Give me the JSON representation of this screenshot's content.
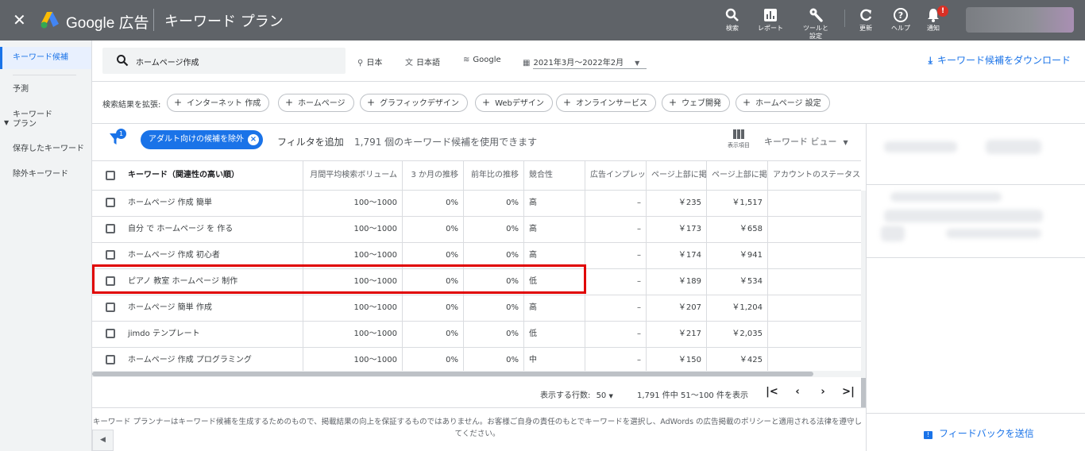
{
  "topbar": {
    "close_icon": "close-icon",
    "brand": "Google 広告",
    "title": "キーワード プラン",
    "tools": [
      {
        "label": "検索",
        "icon": "search-icon"
      },
      {
        "label": "レポート",
        "icon": "reports-icon"
      },
      {
        "label": "ツールと設定",
        "icon": "wrench-icon"
      },
      {
        "label": "更新",
        "icon": "refresh-icon"
      },
      {
        "label": "ヘルプ",
        "icon": "help-icon"
      },
      {
        "label": "通知",
        "icon": "bell-icon",
        "badge": "!"
      }
    ]
  },
  "sidebar": {
    "items": [
      {
        "label": "キーワード候補",
        "active": true
      },
      {
        "label": "予測"
      },
      {
        "label": "キーワード\nプラン",
        "expandable": true
      },
      {
        "label": "保存したキーワード"
      },
      {
        "label": "除外キーワード"
      }
    ]
  },
  "search": {
    "query": "ホームページ作成",
    "location": "日本",
    "language": "日本語",
    "network": "Google",
    "date_range": "2021年3月～2022年2月",
    "download_label": "キーワード候補をダウンロード"
  },
  "expand": {
    "label": "検索結果を拡張:",
    "pills": [
      "インターネット 作成",
      "ホームページ",
      "グラフィックデザイン",
      "Webデザイン",
      "オンラインサービス",
      "ウェブ開発",
      "ホームページ 設定"
    ]
  },
  "filters": {
    "badge": "1",
    "active_chip": "アダルト向けの候補を除外",
    "add_filter": "フィルタを追加",
    "available": "1,791 個のキーワード候補を使用できます",
    "columns_label": "表示項目",
    "view_label": "キーワード ビュー"
  },
  "table": {
    "headers": [
      "キーワード（関連性の高い順）",
      "月間平均検索ボリューム",
      "3 か月の推移",
      "前年比の推移",
      "競合性",
      "広告インプレッション シェア",
      "ページ上部に掲載された入札単価（低額帯）",
      "ページ上部に掲載された入札単価（高額帯）",
      "アカウントのステータス"
    ],
    "header_display": [
      "キーワード（関連性の高い順）",
      "月間平均検索ボリューム",
      "3 か月の推移",
      "前年比の推移",
      "競合性",
      "広告インプレッ",
      "ページ上部に掲",
      "ページ上部に掲",
      "アカウントのステータス"
    ],
    "rows": [
      [
        "ホームページ 作成 簡単",
        "100～1000",
        "0%",
        "0%",
        "高",
        "–",
        "￥235",
        "￥1,517",
        ""
      ],
      [
        "自分 で ホームページ を 作る",
        "100～1000",
        "0%",
        "0%",
        "高",
        "–",
        "￥173",
        "￥658",
        ""
      ],
      [
        "ホームページ 作成 初心者",
        "100～1000",
        "0%",
        "0%",
        "高",
        "–",
        "￥174",
        "￥941",
        ""
      ],
      [
        "ピアノ 教室 ホームページ 制作",
        "100～1000",
        "0%",
        "0%",
        "低",
        "–",
        "￥189",
        "￥534",
        ""
      ],
      [
        "ホームページ 簡単 作成",
        "100～1000",
        "0%",
        "0%",
        "高",
        "–",
        "￥207",
        "￥1,204",
        ""
      ],
      [
        "jimdo テンプレート",
        "100～1000",
        "0%",
        "0%",
        "低",
        "–",
        "￥217",
        "￥2,035",
        ""
      ],
      [
        "ホームページ 作成 プログラミング",
        "100～1000",
        "0%",
        "0%",
        "中",
        "–",
        "￥150",
        "￥425",
        ""
      ]
    ],
    "highlighted_row": 3
  },
  "pager": {
    "rows_label": "表示する行数:",
    "rows_value": "50",
    "range": "1,791 件中 51～100 件を表示"
  },
  "footer": {
    "text": "キーワード プランナーはキーワード候補を生成するためのもので、掲載結果の向上を保証するものではありません。お客様ご自身の責任のもとでキーワードを選択し、AdWords の広告掲載のポリシーと適用される法律を遵守してください。"
  },
  "right_panel": {
    "feedback": "フィードバックを送信"
  },
  "colors": {
    "topbar": "#5f6368",
    "accent": "#1a73e8",
    "highlight": "#e00000"
  }
}
